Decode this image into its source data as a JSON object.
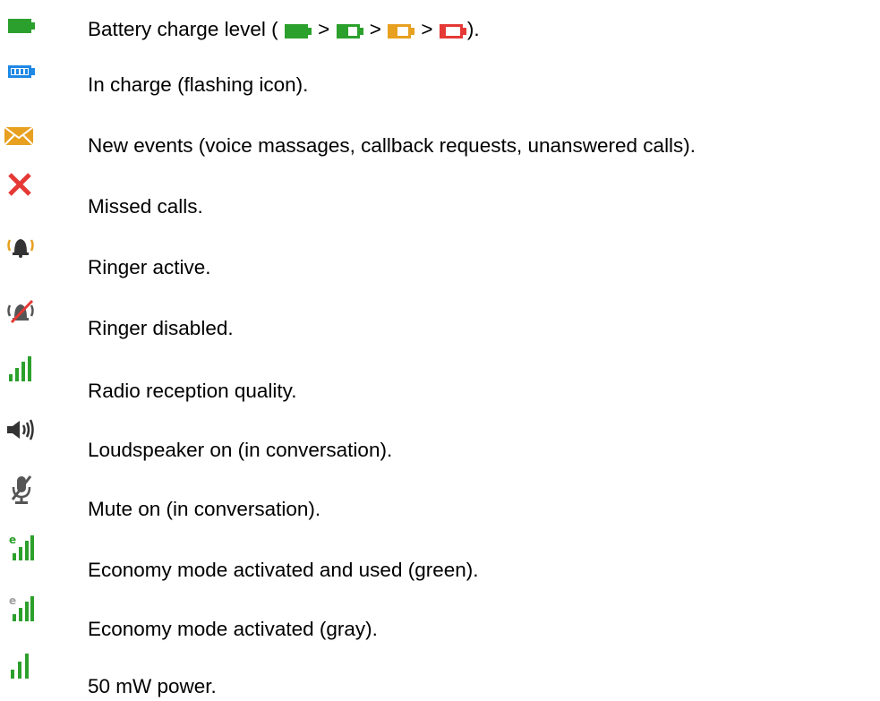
{
  "legend": {
    "items": [
      {
        "icon": "battery-full-icon",
        "label": "Battery charge level ( ",
        "battery_levels": [
          "battery-green-icon",
          "battery-half-green-icon",
          "battery-orange-icon",
          "battery-red-icon"
        ],
        "separator": " > ",
        "suffix": ")."
      },
      {
        "icon": "battery-charging-icon",
        "label": "In charge (flashing icon)."
      },
      {
        "icon": "envelope-icon",
        "label": "New events (voice massages, callback requests, unanswered calls)."
      },
      {
        "icon": "red-x-icon",
        "label": "Missed calls."
      },
      {
        "icon": "bell-ringing-icon",
        "label": "Ringer active."
      },
      {
        "icon": "bell-disabled-icon",
        "label": "Ringer disabled."
      },
      {
        "icon": "signal-bars-icon",
        "label": "Radio reception quality."
      },
      {
        "icon": "loudspeaker-icon",
        "label": "Loudspeaker on (in conversation)."
      },
      {
        "icon": "mute-mic-icon",
        "label": "Mute on (in conversation)."
      },
      {
        "icon": "economy-green-icon",
        "label": "Economy mode activated and used (green)."
      },
      {
        "icon": "economy-gray-icon",
        "label": "Economy mode activated (gray)."
      },
      {
        "icon": "power-50mw-icon",
        "label": "50 mW power."
      }
    ]
  },
  "colors": {
    "green": "#2ca02c",
    "blue": "#1e88e5",
    "orange": "#e8a020",
    "red": "#e53935",
    "gray": "#9e9e9e",
    "dark": "#404040"
  }
}
